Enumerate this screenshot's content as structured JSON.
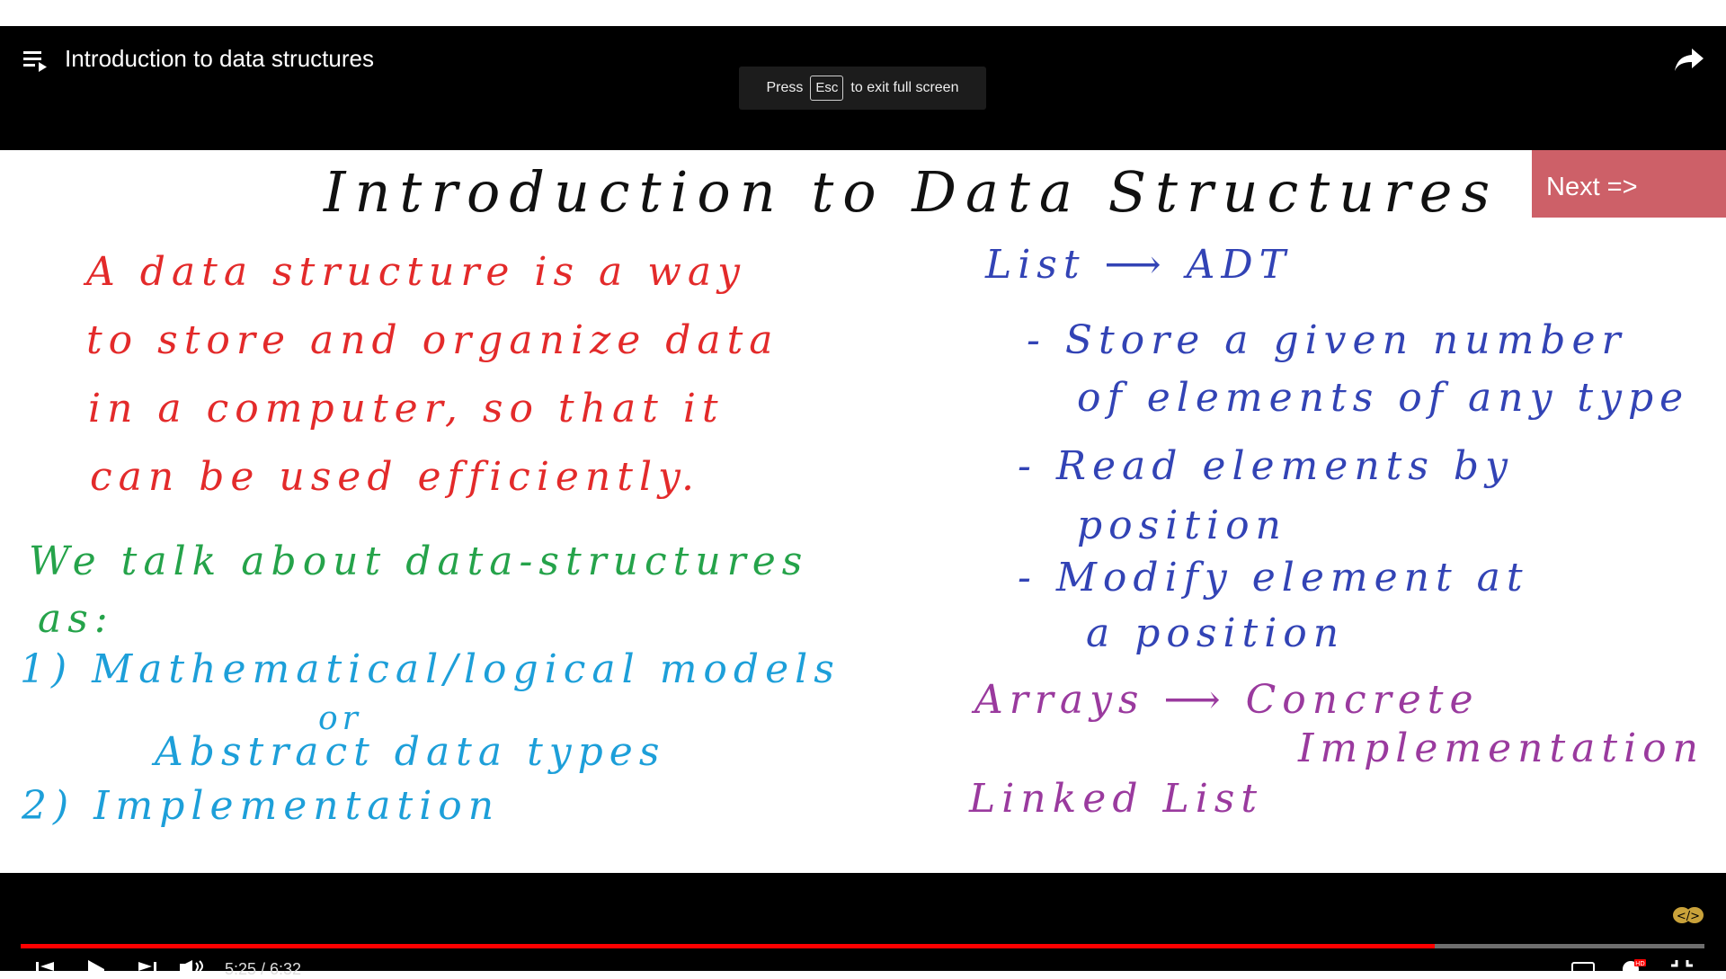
{
  "player": {
    "title": "Introduction to data structures",
    "esc_toast": {
      "press": "Press",
      "key": "Esc",
      "suffix": "to exit full screen"
    },
    "next_button": "Next =>",
    "time": "5:25 / 6:32",
    "progress": 0.84
  },
  "slide": {
    "title": "Introduction to Data Structures",
    "definition_lines": [
      "A  data  structure  is  a way",
      "to  store  and  organize  data",
      "in    a   computer,  so that  it",
      "can    be  used   efficiently."
    ],
    "talk_lines": [
      "We  talk  about  data-structures",
      "as:"
    ],
    "model_1": "1)  Mathematical/logical  models",
    "or": "or",
    "adt_line": "Abstract  data  types",
    "model_2": "2)  Implementation",
    "list_heading": "List  ⟶  ADT",
    "list_items": [
      "-  Store  a  given  number",
      "of  elements  of any type",
      "-  Read  elements  by",
      "position",
      "-  Modify  element  at",
      "a  position"
    ],
    "arrays_line": "Arrays  ⟶  Concrete",
    "implementation_word": "Implementation",
    "linked_list": "Linked List"
  },
  "colors": {
    "red": "#e32a2a",
    "green": "#25a34a",
    "blue": "#1d9fd9",
    "navy": "#3243b5",
    "purple": "#9a3a9e",
    "next_bg": "#cd6068",
    "progress": "#ff0000"
  },
  "icons": [
    "playlist-icon",
    "share-icon",
    "previous-icon",
    "play-icon",
    "next-track-icon",
    "volume-icon",
    "subtitles-icon",
    "settings-icon",
    "fullscreen-exit-icon",
    "channel-watermark-icon"
  ]
}
